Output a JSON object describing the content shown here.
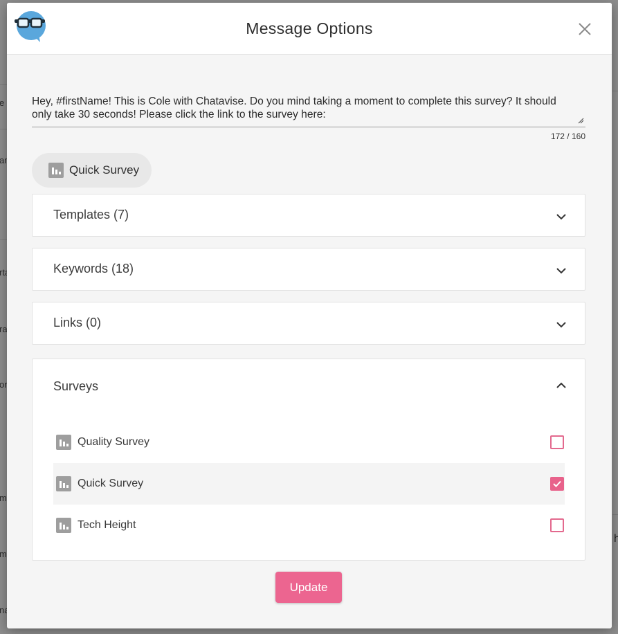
{
  "background": {
    "left_fragments": [
      "e",
      "an",
      "rta",
      "ra",
      "on",
      "m",
      "m",
      "na"
    ],
    "right_fragment": "hi"
  },
  "modal": {
    "title": "Message Options",
    "close_icon": "close-icon",
    "logo_icon": "chatavise-glasses-bubble-logo"
  },
  "message": {
    "text": "Hey, #firstName! This is Cole with Chatavise. Do you mind taking a moment to complete this survey? It should only take 30 seconds! Please click the link to the survey here:",
    "char_count": "172 / 160"
  },
  "attachment_chip": {
    "label": "Quick Survey",
    "icon": "bar-chart-icon"
  },
  "panels": {
    "templates": {
      "label": "Templates (7)",
      "expanded": false
    },
    "keywords": {
      "label": "Keywords (18)",
      "expanded": false
    },
    "links": {
      "label": "Links (0)",
      "expanded": false
    },
    "surveys": {
      "label": "Surveys",
      "expanded": true,
      "items": [
        {
          "label": "Quality Survey",
          "checked": false
        },
        {
          "label": "Quick Survey",
          "checked": true
        },
        {
          "label": "Tech Height",
          "checked": false
        }
      ]
    }
  },
  "actions": {
    "update_label": "Update"
  },
  "colors": {
    "accent": "#ec6590",
    "icon_gray": "#9e9e9e",
    "logo_blue": "#5aa7dc"
  }
}
